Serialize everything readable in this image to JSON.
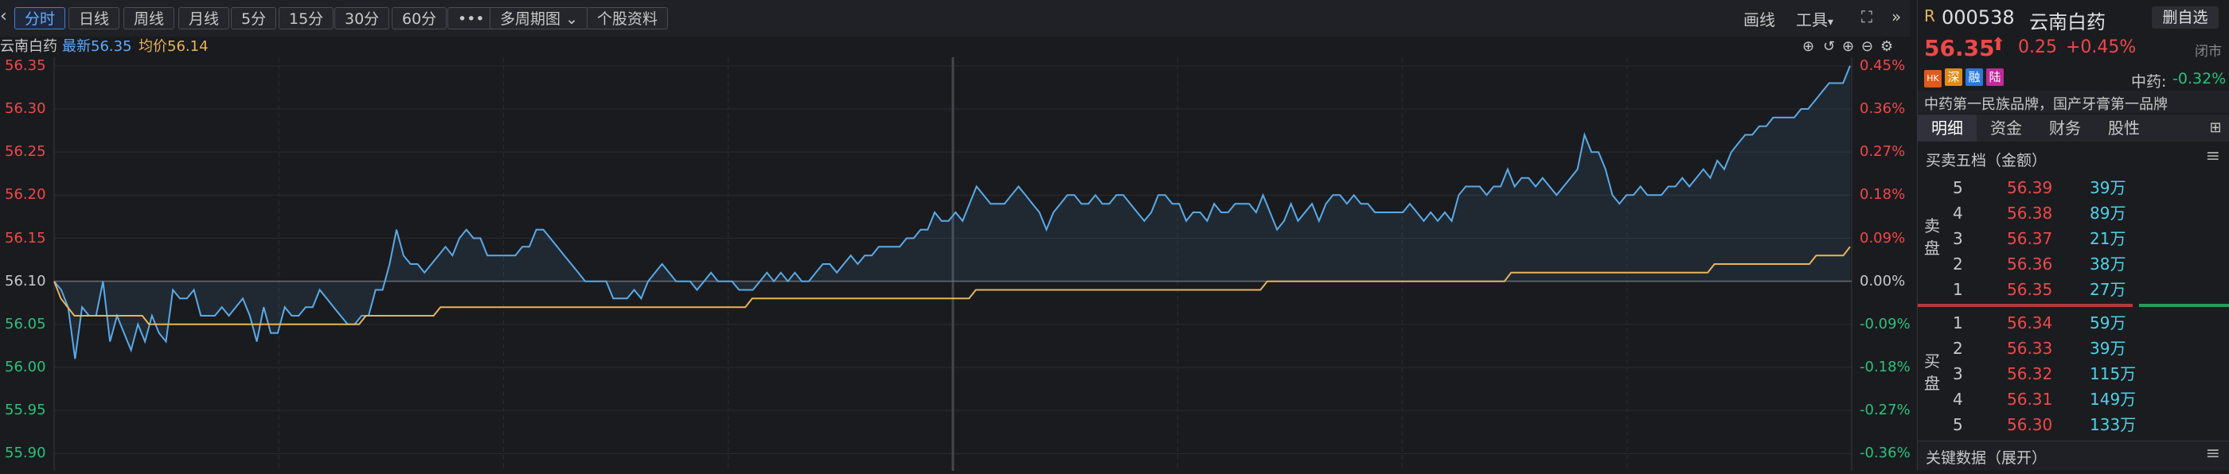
{
  "toolbar": {
    "back_icon": "chevron-left-icon",
    "periods": [
      "分时",
      "日线",
      "周线",
      "月线",
      "5分",
      "15分",
      "30分",
      "60分"
    ],
    "more_label": "•••",
    "multi_period_label": "多周期图",
    "stock_info_label": "个股资料",
    "draw_label": "画线",
    "tools_label": "工具",
    "fullscreen_icon": "expand-icon",
    "collapse_icon": "double-chevron-right-icon"
  },
  "info": {
    "stock_name": "云南白药",
    "latest_label": "最新56.35",
    "avg_label": "均价56.14"
  },
  "chart_data": {
    "type": "line",
    "title": "",
    "y_left_ticks": [
      "56.35",
      "56.30",
      "56.25",
      "56.20",
      "56.15",
      "56.10",
      "56.05",
      "56.00",
      "55.95",
      "55.90"
    ],
    "y_right_ticks": [
      "0.45%",
      "0.36%",
      "0.27%",
      "0.18%",
      "0.09%",
      "0.00%",
      "-0.09%",
      "-0.18%",
      "-0.27%",
      "-0.36%"
    ],
    "ylim": [
      55.88,
      56.36
    ],
    "prev_close": 56.1,
    "series": [
      {
        "color": "#5aa9e6",
        "values": [
          56.1,
          56.09,
          56.07,
          56.01,
          56.07,
          56.06,
          56.06,
          56.1,
          56.03,
          56.06,
          56.04,
          56.02,
          56.05,
          56.03,
          56.06,
          56.04,
          56.03,
          56.09,
          56.08,
          56.08,
          56.09,
          56.06,
          56.06,
          56.06,
          56.07,
          56.06,
          56.07,
          56.08,
          56.06,
          56.03,
          56.07,
          56.04,
          56.04,
          56.07,
          56.06,
          56.06,
          56.07,
          56.07,
          56.09,
          56.08,
          56.07,
          56.06,
          56.05,
          56.05,
          56.06,
          56.06,
          56.09,
          56.09,
          56.12,
          56.16,
          56.13,
          56.12,
          56.12,
          56.11,
          56.12,
          56.13,
          56.14,
          56.13,
          56.15,
          56.16,
          56.15,
          56.15,
          56.13,
          56.13,
          56.13,
          56.13,
          56.13,
          56.14,
          56.14,
          56.16,
          56.16,
          56.15,
          56.14,
          56.13,
          56.12,
          56.11,
          56.1,
          56.1,
          56.1,
          56.1,
          56.08,
          56.08,
          56.08,
          56.09,
          56.08,
          56.1,
          56.11,
          56.12,
          56.11,
          56.1,
          56.1,
          56.1,
          56.09,
          56.1,
          56.11,
          56.1,
          56.1,
          56.1,
          56.09,
          56.09,
          56.09,
          56.1,
          56.11,
          56.1,
          56.11,
          56.1,
          56.11,
          56.1,
          56.1,
          56.11,
          56.12,
          56.12,
          56.11,
          56.12,
          56.13,
          56.12,
          56.13,
          56.13,
          56.14,
          56.14,
          56.14,
          56.14,
          56.15,
          56.15,
          56.16,
          56.16,
          56.18,
          56.17,
          56.17,
          56.18,
          56.17,
          56.19,
          56.21,
          56.2,
          56.19,
          56.19,
          56.19,
          56.2,
          56.21,
          56.2,
          56.19,
          56.18,
          56.16,
          56.18,
          56.19,
          56.2,
          56.2,
          56.19,
          56.19,
          56.2,
          56.19,
          56.19,
          56.2,
          56.2,
          56.19,
          56.18,
          56.17,
          56.18,
          56.2,
          56.2,
          56.19,
          56.19,
          56.17,
          56.18,
          56.18,
          56.17,
          56.19,
          56.18,
          56.18,
          56.19,
          56.19,
          56.19,
          56.18,
          56.2,
          56.18,
          56.16,
          56.17,
          56.19,
          56.17,
          56.18,
          56.19,
          56.17,
          56.19,
          56.2,
          56.2,
          56.19,
          56.2,
          56.19,
          56.19,
          56.18,
          56.18,
          56.18,
          56.18,
          56.18,
          56.19,
          56.18,
          56.17,
          56.18,
          56.17,
          56.18,
          56.17,
          56.2,
          56.21,
          56.21,
          56.21,
          56.2,
          56.21,
          56.21,
          56.23,
          56.21,
          56.22,
          56.22,
          56.21,
          56.22,
          56.21,
          56.2,
          56.21,
          56.22,
          56.23,
          56.27,
          56.25,
          56.25,
          56.23,
          56.2,
          56.19,
          56.2,
          56.2,
          56.21,
          56.2,
          56.2,
          56.2,
          56.21,
          56.21,
          56.22,
          56.21,
          56.22,
          56.23,
          56.22,
          56.24,
          56.23,
          56.25,
          56.26,
          56.27,
          56.27,
          56.28,
          56.28,
          56.29,
          56.29,
          56.29,
          56.29,
          56.3,
          56.3,
          56.31,
          56.32,
          56.33,
          56.33,
          56.33,
          56.35
        ]
      },
      {
        "color": "#e8b45a",
        "values": [
          56.1,
          56.08,
          56.07,
          56.06,
          56.06,
          56.06,
          56.06,
          56.06,
          56.06,
          56.06,
          56.06,
          56.06,
          56.06,
          56.06,
          56.05,
          56.05,
          56.05,
          56.05,
          56.05,
          56.05,
          56.05,
          56.05,
          56.05,
          56.05,
          56.05,
          56.05,
          56.05,
          56.05,
          56.05,
          56.05,
          56.05,
          56.05,
          56.05,
          56.05,
          56.05,
          56.05,
          56.05,
          56.05,
          56.05,
          56.05,
          56.05,
          56.05,
          56.05,
          56.05,
          56.05,
          56.05,
          56.06,
          56.06,
          56.06,
          56.06,
          56.06,
          56.06,
          56.06,
          56.06,
          56.06,
          56.06,
          56.06,
          56.07,
          56.07,
          56.07,
          56.07,
          56.07,
          56.07,
          56.07,
          56.07,
          56.07,
          56.07,
          56.07,
          56.07,
          56.07,
          56.07,
          56.07,
          56.07,
          56.07,
          56.07,
          56.07,
          56.07,
          56.07,
          56.07,
          56.07,
          56.07,
          56.07,
          56.07,
          56.07,
          56.07,
          56.07,
          56.07,
          56.07,
          56.07,
          56.07,
          56.07,
          56.07,
          56.07,
          56.07,
          56.07,
          56.07,
          56.07,
          56.07,
          56.07,
          56.07,
          56.07,
          56.07,
          56.07,
          56.08,
          56.08,
          56.08,
          56.08,
          56.08,
          56.08,
          56.08,
          56.08,
          56.08,
          56.08,
          56.08,
          56.08,
          56.08,
          56.08,
          56.08,
          56.08,
          56.08,
          56.08,
          56.08,
          56.08,
          56.08,
          56.08,
          56.08,
          56.08,
          56.08,
          56.08,
          56.08,
          56.08,
          56.08,
          56.08,
          56.08,
          56.08,
          56.08,
          56.09,
          56.09,
          56.09,
          56.09,
          56.09,
          56.09,
          56.09,
          56.09,
          56.09,
          56.09,
          56.09,
          56.09,
          56.09,
          56.09,
          56.09,
          56.09,
          56.09,
          56.09,
          56.09,
          56.09,
          56.09,
          56.09,
          56.09,
          56.09,
          56.09,
          56.09,
          56.09,
          56.09,
          56.09,
          56.09,
          56.09,
          56.09,
          56.09,
          56.09,
          56.09,
          56.09,
          56.09,
          56.09,
          56.09,
          56.09,
          56.09,
          56.09,
          56.09,
          56.1,
          56.1,
          56.1,
          56.1,
          56.1,
          56.1,
          56.1,
          56.1,
          56.1,
          56.1,
          56.1,
          56.1,
          56.1,
          56.1,
          56.1,
          56.1,
          56.1,
          56.1,
          56.1,
          56.1,
          56.1,
          56.1,
          56.1,
          56.1,
          56.1,
          56.1,
          56.1,
          56.1,
          56.1,
          56.1,
          56.1,
          56.1,
          56.1,
          56.1,
          56.1,
          56.1,
          56.11,
          56.11,
          56.11,
          56.11,
          56.11,
          56.11,
          56.11,
          56.11,
          56.11,
          56.11,
          56.11,
          56.11,
          56.11,
          56.11,
          56.11,
          56.11,
          56.11,
          56.11,
          56.11,
          56.11,
          56.11,
          56.11,
          56.11,
          56.11,
          56.11,
          56.11,
          56.11,
          56.11,
          56.11,
          56.11,
          56.12,
          56.12,
          56.12,
          56.12,
          56.12,
          56.12,
          56.12,
          56.12,
          56.12,
          56.12,
          56.12,
          56.12,
          56.12,
          56.12,
          56.12,
          56.13,
          56.13,
          56.13,
          56.13,
          56.13,
          56.14
        ]
      }
    ]
  },
  "quote": {
    "code_prefix": "R",
    "code": "000538",
    "name": "云南白药",
    "delete_label": "删自选",
    "price": "56.35",
    "change": "0.25",
    "pct": "+0.45%",
    "status": "闭市",
    "tags": [
      "HK",
      "深",
      "融",
      "陆"
    ],
    "sector_label": "中药:",
    "sector_pct": "-0.32%",
    "slogan": "中药第一民族品牌，国产牙膏第一品牌"
  },
  "tabs": [
    "明细",
    "资金",
    "财务",
    "股性"
  ],
  "orderbook": {
    "title": "买卖五档（金额）",
    "sell_label": [
      "卖",
      "盘"
    ],
    "buy_label": [
      "买",
      "盘"
    ],
    "sell": [
      {
        "level": "5",
        "price": "56.39",
        "amount": "39万"
      },
      {
        "level": "4",
        "price": "56.38",
        "amount": "89万"
      },
      {
        "level": "3",
        "price": "56.37",
        "amount": "21万"
      },
      {
        "level": "2",
        "price": "56.36",
        "amount": "38万"
      },
      {
        "level": "1",
        "price": "56.35",
        "amount": "27万"
      }
    ],
    "buy": [
      {
        "level": "1",
        "price": "56.34",
        "amount": "59万"
      },
      {
        "level": "2",
        "price": "56.33",
        "amount": "39万"
      },
      {
        "level": "3",
        "price": "56.32",
        "amount": "115万"
      },
      {
        "level": "4",
        "price": "56.31",
        "amount": "149万"
      },
      {
        "level": "5",
        "price": "56.30",
        "amount": "133万"
      }
    ],
    "key_data_label": "关键数据（展开）"
  }
}
